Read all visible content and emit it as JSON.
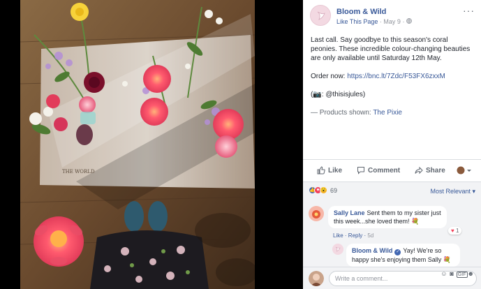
{
  "post": {
    "page_name": "Bloom & Wild",
    "like_page": "Like This Page",
    "separator": "·",
    "date": "May 9",
    "paragraphs": {
      "p1": "Last call. Say goodbye to this season's coral peonies. These incredible colour-changing beauties are only available until Saturday 12th May.",
      "order_prefix": "Order now: ",
      "order_link": "https://bnc.lt/7Zdc/F53FX6zxxM",
      "credit": "(📷: @thisisjules)",
      "products_prefix": "— Products shown: ",
      "products_link": "The Pixie"
    },
    "photo_text": "THE WORLD"
  },
  "actions": {
    "like": "Like",
    "comment": "Comment",
    "share": "Share"
  },
  "reactions": {
    "count": "69",
    "sort": "Most Relevant ▾"
  },
  "comments": [
    {
      "author": "Sally Lane",
      "text": "Sent them to my sister just this week...she loved them! 💐",
      "like": "Like",
      "reply": "Reply",
      "time": "5d",
      "reaction_count": "1"
    },
    {
      "author": "Bloom & Wild",
      "text": "Yay! We're so happy she's enjoying them Sally 💐"
    }
  ],
  "composer": {
    "placeholder": "Write a comment..."
  },
  "colors": {
    "link": "#385898",
    "like_blue": "#4267b2",
    "love_red": "#f33e58",
    "panel_bg": "#f2f3f5"
  }
}
